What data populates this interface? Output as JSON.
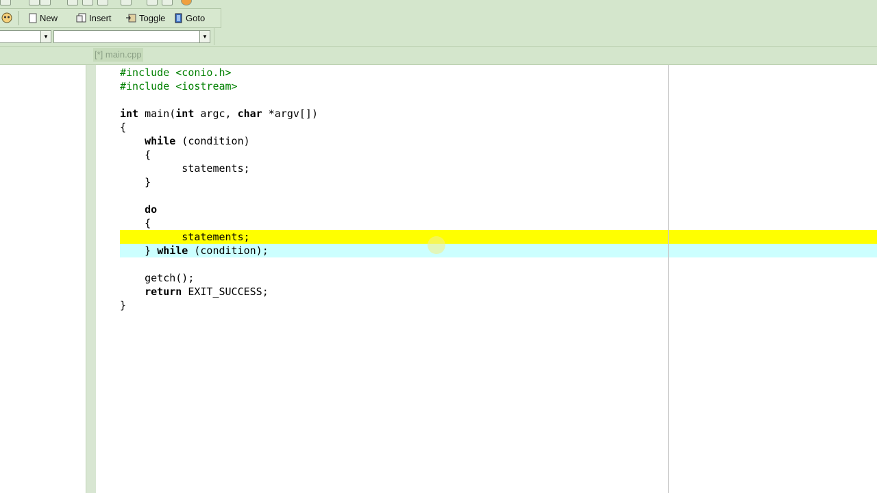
{
  "toolbar": {
    "new_label": "New",
    "insert_label": "Insert",
    "toggle_label": "Toggle",
    "goto_label": "Goto"
  },
  "selectors": {
    "class_value": "",
    "member_value": ""
  },
  "tabs": [
    {
      "label": "[*] main.cpp"
    }
  ],
  "code": {
    "lines": [
      "#include <conio.h>",
      "#include <iostream>",
      "",
      "int main(int argc, char *argv[])",
      "{",
      "    while (condition)",
      "    {",
      "          statements;",
      "    }",
      "",
      "    do",
      "    {",
      "          statements;",
      "    } while (condition);",
      "",
      "    getch();",
      "    return EXIT_SUCCESS;",
      "}"
    ]
  },
  "colors": {
    "toolbar_bg": "#d4e6cc",
    "active_line": "#ffff00",
    "secondary_line": "#ccffff",
    "preprocessor": "#008000"
  },
  "icons": [
    "debug-icon",
    "new-file-icon",
    "insert-icon",
    "toggle-bookmark-icon",
    "goto-bookmark-icon",
    "dropdown-arrow-icon"
  ]
}
